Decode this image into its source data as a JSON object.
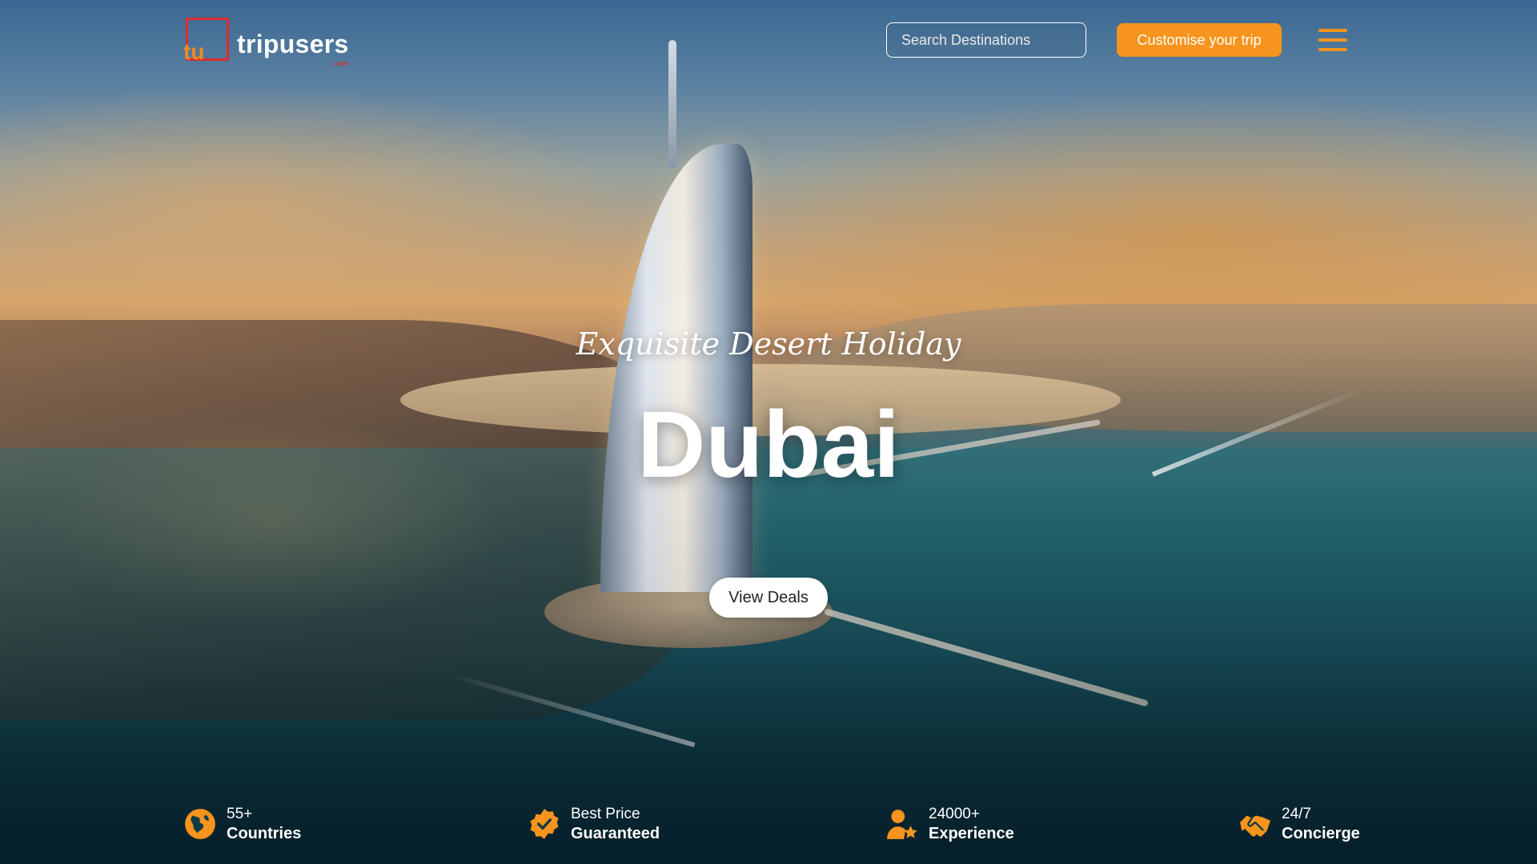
{
  "brand": {
    "mark": "tu",
    "name": "tripusers",
    "sub": ".com",
    "logo_red": "#e02b2b",
    "logo_orange": "#f08a1c"
  },
  "header": {
    "search": {
      "placeholder": "Search Destinations",
      "value": ""
    },
    "cta_label": "Customise your trip",
    "accent": "#f7941d"
  },
  "hero": {
    "tagline": "Exquisite Desert Holiday",
    "city": "Dubai",
    "button_label": "View Deals"
  },
  "features": [
    {
      "icon": "globe-icon",
      "top": "55+",
      "bottom": "Countries"
    },
    {
      "icon": "verified-badge-icon",
      "top": "Best Price",
      "bottom": "Guaranteed"
    },
    {
      "icon": "user-star-icon",
      "top": "24000+",
      "bottom": "Experience"
    },
    {
      "icon": "handshake-icon",
      "top": "24/7",
      "bottom": "Concierge"
    }
  ]
}
